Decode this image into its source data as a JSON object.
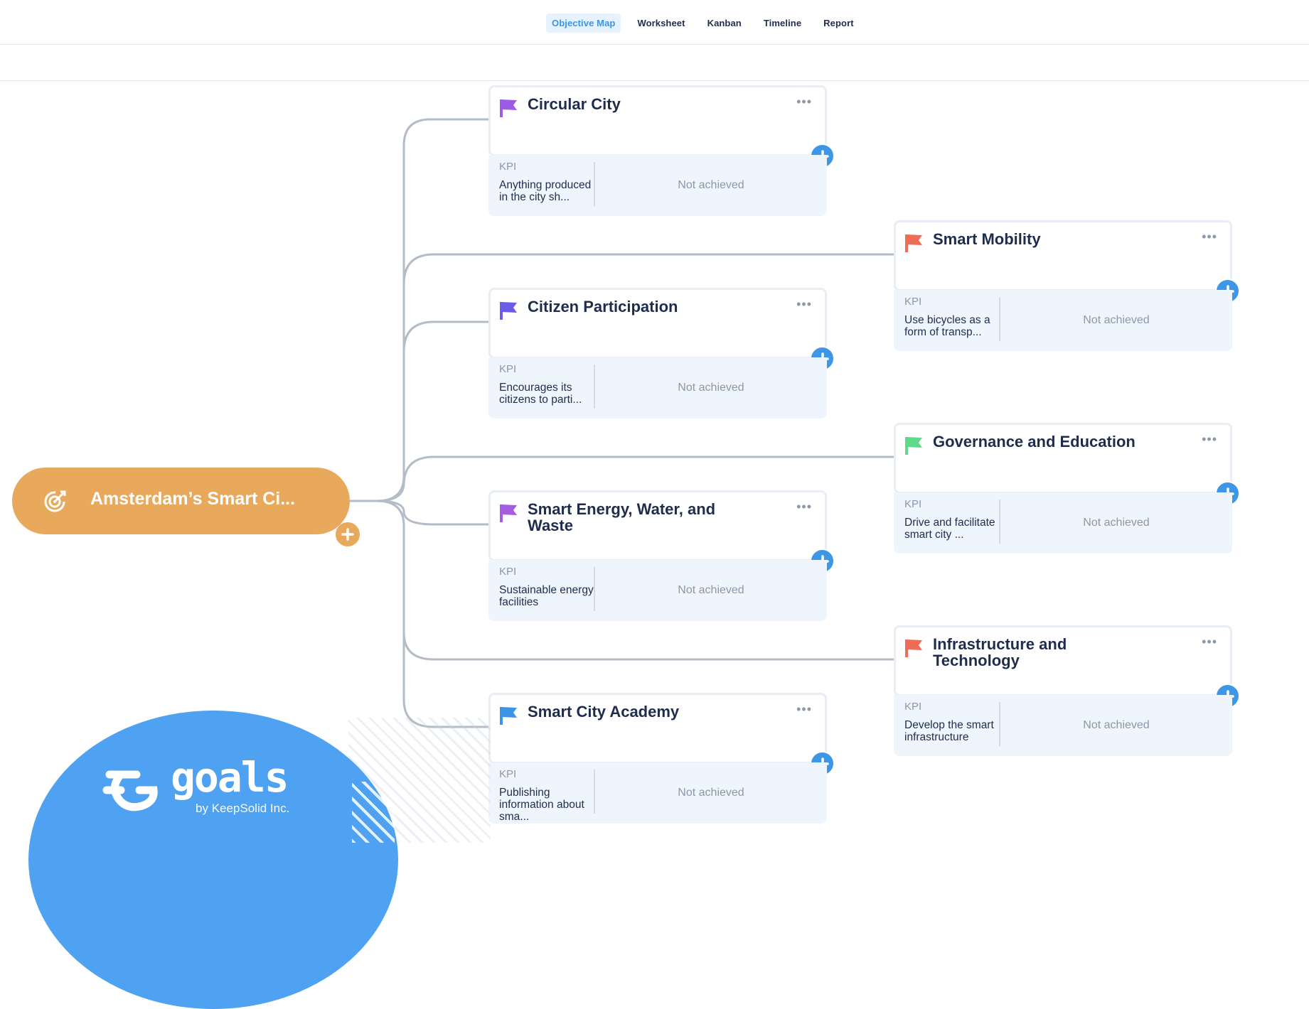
{
  "nav": {
    "tabs": [
      {
        "label": "Objective Map",
        "active": true
      },
      {
        "label": "Worksheet",
        "active": false
      },
      {
        "label": "Kanban",
        "active": false
      },
      {
        "label": "Timeline",
        "active": false
      },
      {
        "label": "Report",
        "active": false
      }
    ]
  },
  "root": {
    "title": "Amsterdam’s Smart Ci...",
    "icon": "target-icon",
    "color": "#e8a95c"
  },
  "objectives": [
    {
      "title": "Circular City",
      "flag_color": "#9b5de5",
      "kpi_label": "KPI",
      "kpi_text": "Anything produced in the city sh...",
      "status": "Not achieved"
    },
    {
      "title": "Smart Mobility",
      "flag_color": "#ef6c57",
      "kpi_label": "KPI",
      "kpi_text": "Use bicycles as a form of transp...",
      "status": "Not achieved"
    },
    {
      "title": "Citizen Participation",
      "flag_color": "#6c5ce7",
      "kpi_label": "KPI",
      "kpi_text": "Encourages its citizens to parti...",
      "status": "Not achieved"
    },
    {
      "title": "Governance and Education",
      "flag_color": "#5fd98a",
      "kpi_label": "KPI",
      "kpi_text": "Drive and facilitate smart city ...",
      "status": "Not achieved"
    },
    {
      "title": "Smart Energy, Water, and Waste",
      "flag_color": "#a45de0",
      "kpi_label": "KPI",
      "kpi_text": "Sustainable energy facilities",
      "status": "Not achieved"
    },
    {
      "title": "Infrastructure and Technology",
      "flag_color": "#ef6c57",
      "kpi_label": "KPI",
      "kpi_text": "Develop the smart infrastructure",
      "status": "Not achieved"
    },
    {
      "title": "Smart City Academy",
      "flag_color": "#3a95e8",
      "kpi_label": "KPI",
      "kpi_text": "Publishing information about sma...",
      "status": "Not achieved"
    }
  ],
  "branding": {
    "name": "goals",
    "byline": "by KeepSolid Inc.",
    "color": "#4ea2f1"
  },
  "colors": {
    "accent": "#3d96e6",
    "connector": "#b3bcc7",
    "kpi_bg": "#eef5fd"
  }
}
